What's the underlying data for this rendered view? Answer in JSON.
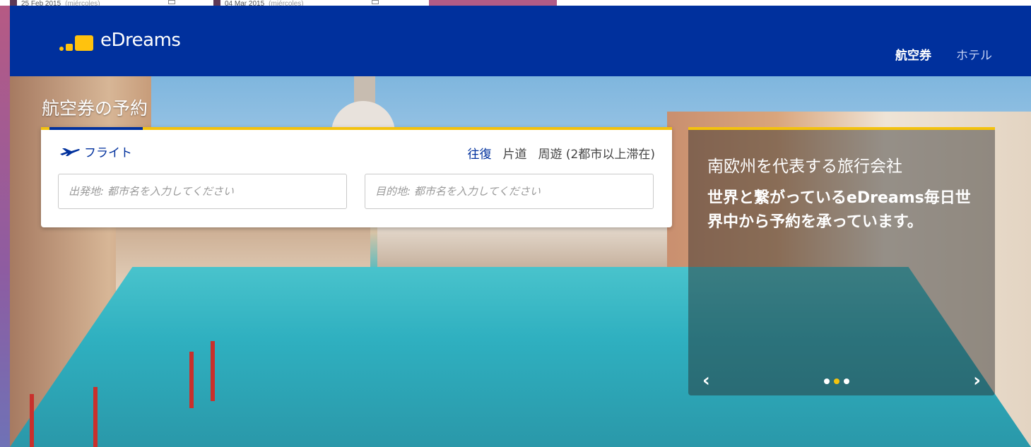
{
  "top_strip": {
    "date1": "25 Feb 2015",
    "date1_day": "(miércoles)",
    "date2": "04 Mar 2015",
    "date2_day": "(miércoles)"
  },
  "header": {
    "brand": "eDreams",
    "nav": [
      {
        "label": "航空券"
      },
      {
        "label": "ホテル"
      }
    ]
  },
  "hero": {
    "section_title": "航空券の予約"
  },
  "search": {
    "tab_label": "フライト",
    "trip_types": [
      "往復",
      "片道",
      "周遊 (2都市以上滞在)"
    ],
    "from_placeholder": "出発地: 都市名を入力してください",
    "to_placeholder": "目的地: 都市名を入力してください"
  },
  "promo": {
    "line1": "南欧州を代表する旅行会社",
    "line2": "世界と繋がっているeDreams毎日世界中から予約を承っています。",
    "prev": "‹",
    "next": "›",
    "slides": 3,
    "active_slide": 2
  },
  "colors": {
    "header": "#00309d",
    "accent": "#f3c20e"
  }
}
